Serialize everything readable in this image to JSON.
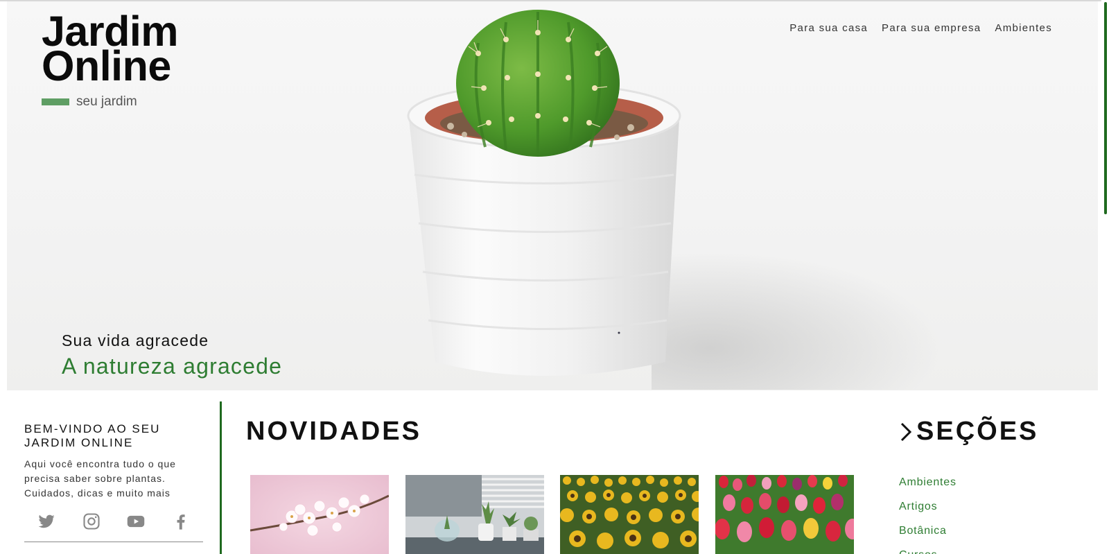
{
  "logo": {
    "line1": "Jardim",
    "line2": "Online",
    "subtitle": "seu jardim"
  },
  "nav": [
    {
      "label": "Para sua casa"
    },
    {
      "label": "Para sua empresa"
    },
    {
      "label": "Ambientes"
    }
  ],
  "hero": {
    "line1": "Sua vida agracede",
    "line2": "A natureza agracede"
  },
  "welcome": {
    "title_line1": "BEM-VINDO AO SEU",
    "title_line2": "JARDIM ONLINE",
    "text_line1": "Aqui você encontra tudo o que",
    "text_line2": "precisa saber sobre plantas.",
    "text_line3": "Cuidados, dicas e muito mais"
  },
  "social": [
    "twitter-icon",
    "instagram-icon",
    "youtube-icon",
    "facebook-icon"
  ],
  "novidades": {
    "title": "NOVIDADES",
    "images": [
      "cherry-blossom-image",
      "succulents-shelf-image",
      "sunflower-field-image",
      "tulip-field-image"
    ]
  },
  "secoes": {
    "title": "SEÇÕES",
    "items": [
      {
        "label": "Ambientes"
      },
      {
        "label": "Artigos"
      },
      {
        "label": "Botânica"
      },
      {
        "label": "Cursos"
      }
    ]
  },
  "colors": {
    "accent": "#2e7d32",
    "logo_bar": "#5f9e64",
    "scrollbar": "#1f6a1f"
  }
}
